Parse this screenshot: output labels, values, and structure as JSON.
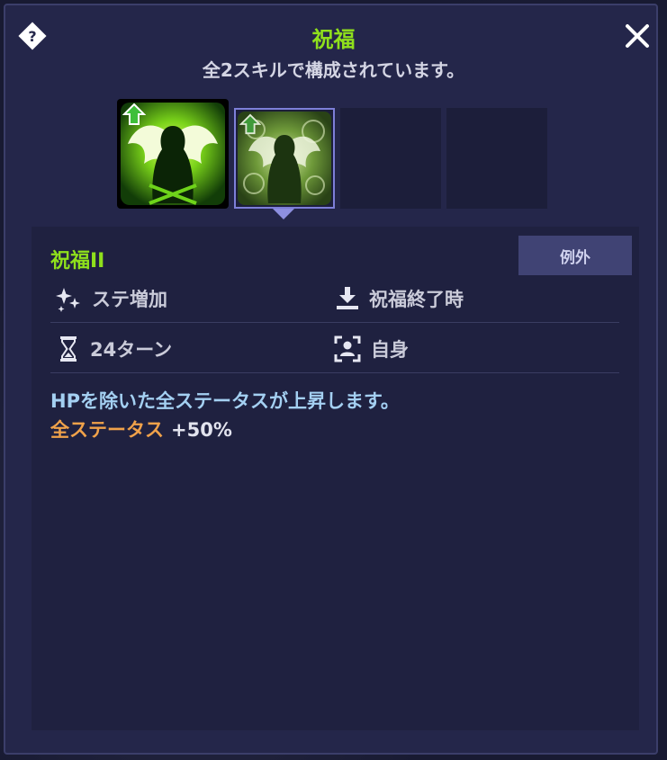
{
  "header": {
    "title": "祝福",
    "subtitle": "全2スキルで構成されています。"
  },
  "skill_slots": [
    {
      "icon": "angel-wings-icon",
      "state": "filled"
    },
    {
      "icon": "angel-wings-icon",
      "state": "selected"
    },
    {
      "state": "empty"
    },
    {
      "state": "empty"
    }
  ],
  "detail": {
    "skill_name": "祝福II",
    "tag": "例外",
    "stats": {
      "effect_type": "ステ増加",
      "end_condition": "祝福終了時",
      "duration": "24ターン",
      "target": "自身"
    },
    "description": "HPを除いた全ステータスが上昇します。",
    "effect_label": "全ステータス",
    "effect_value": "+50%"
  },
  "colors": {
    "accent_green": "#8fe01c",
    "effect_orange": "#f0a24a",
    "description_blue": "#a4d0f2"
  }
}
